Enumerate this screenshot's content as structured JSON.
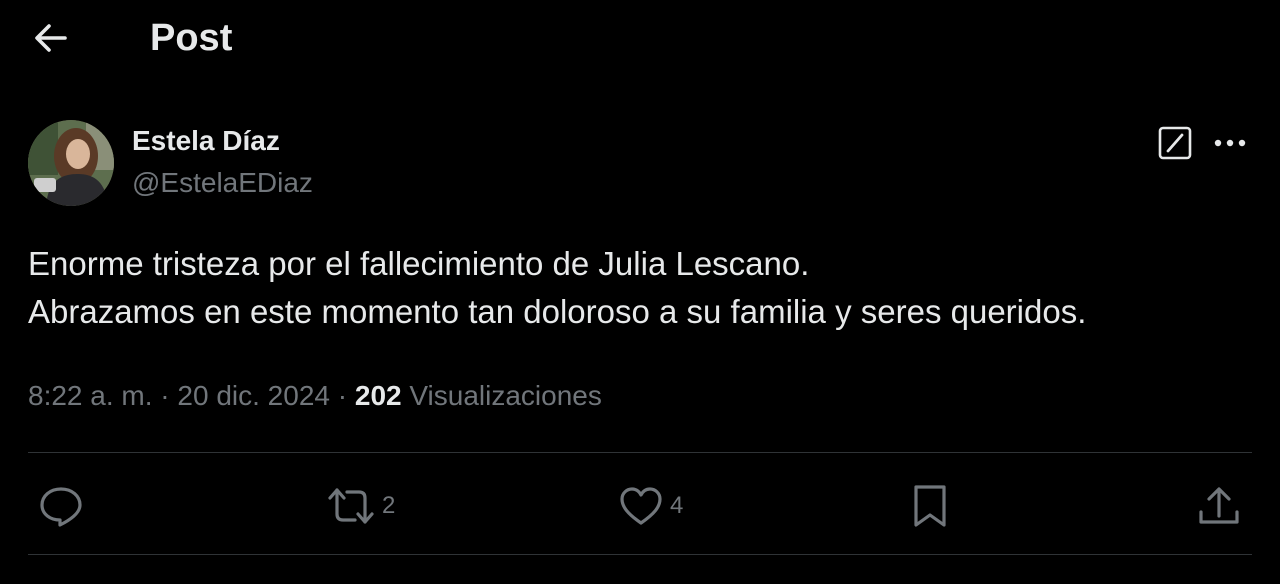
{
  "header": {
    "title": "Post"
  },
  "post": {
    "author": {
      "name": "Estela Díaz",
      "handle": "@EstelaEDiaz"
    },
    "text_lines": [
      "Enorme tristeza por el fallecimiento de Julia Lescano.",
      "Abrazamos en este momento tan doloroso a su familia y seres queridos."
    ],
    "time": "8:22 a. m.",
    "separator": "·",
    "date": "20 dic. 2024",
    "views_count": "202",
    "views_label": "Visualizaciones"
  },
  "actions": {
    "reply_icon": "reply-icon",
    "repost_icon": "repost-icon",
    "repost_count": "2",
    "like_icon": "heart-icon",
    "like_count": "4",
    "bookmark_icon": "bookmark-icon",
    "share_icon": "share-icon"
  },
  "colors": {
    "background": "#000000",
    "primary_text": "#e7e9ea",
    "secondary_text": "#71767b",
    "divider": "#2f3336"
  }
}
